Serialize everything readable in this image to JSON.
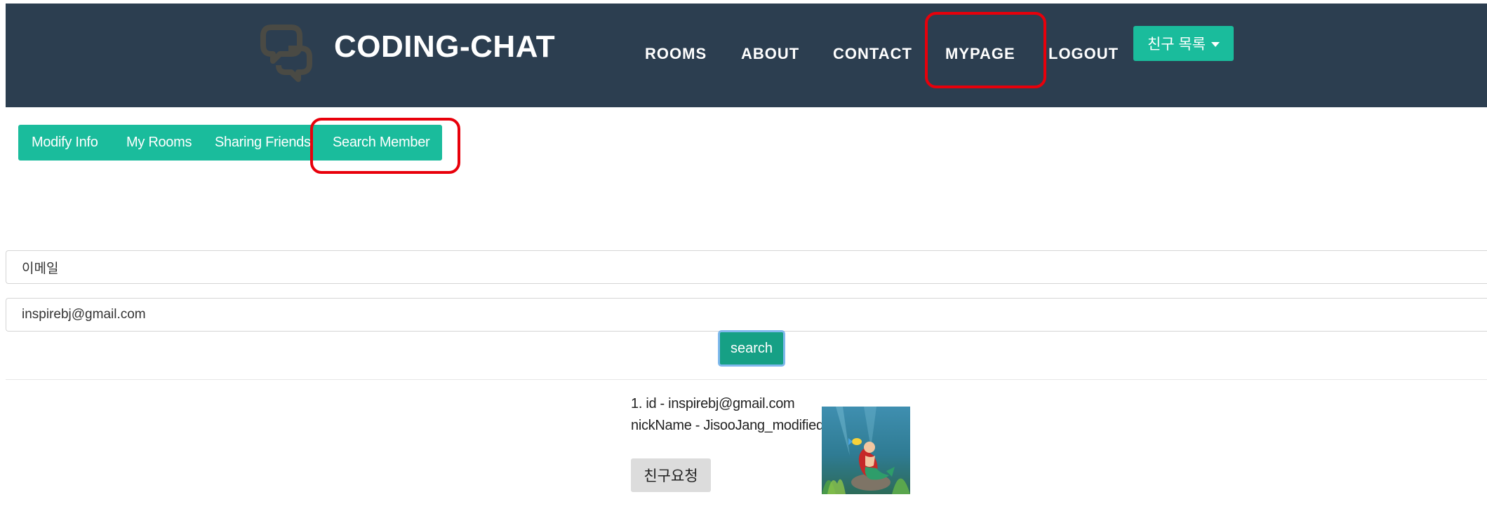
{
  "header": {
    "brand": "CODING-CHAT",
    "nav": {
      "rooms": "ROOMS",
      "about": "ABOUT",
      "contact": "CONTACT",
      "mypage": "MYPAGE",
      "logout": "LOGOUT"
    },
    "friends_dropdown": "친구 목록",
    "logo_icon": "chat-bubbles-icon"
  },
  "subnav": {
    "items": [
      "Modify Info",
      "My Rooms",
      "Sharing Friends",
      "Search Member"
    ]
  },
  "search_form": {
    "label_value": "이메일",
    "email_value": "inspirebj@gmail.com",
    "button_label": "search"
  },
  "result": {
    "id_line": "1. id - inspirebj@gmail.com",
    "nick_line": "nickName - JisooJang_modified",
    "friend_request_label": "친구요청",
    "avatar_icon": "profile-image"
  },
  "colors": {
    "header_bg": "#2c3e50",
    "accent": "#1abc9c",
    "search_button": "#16a085",
    "highlight": "#e8000b"
  }
}
